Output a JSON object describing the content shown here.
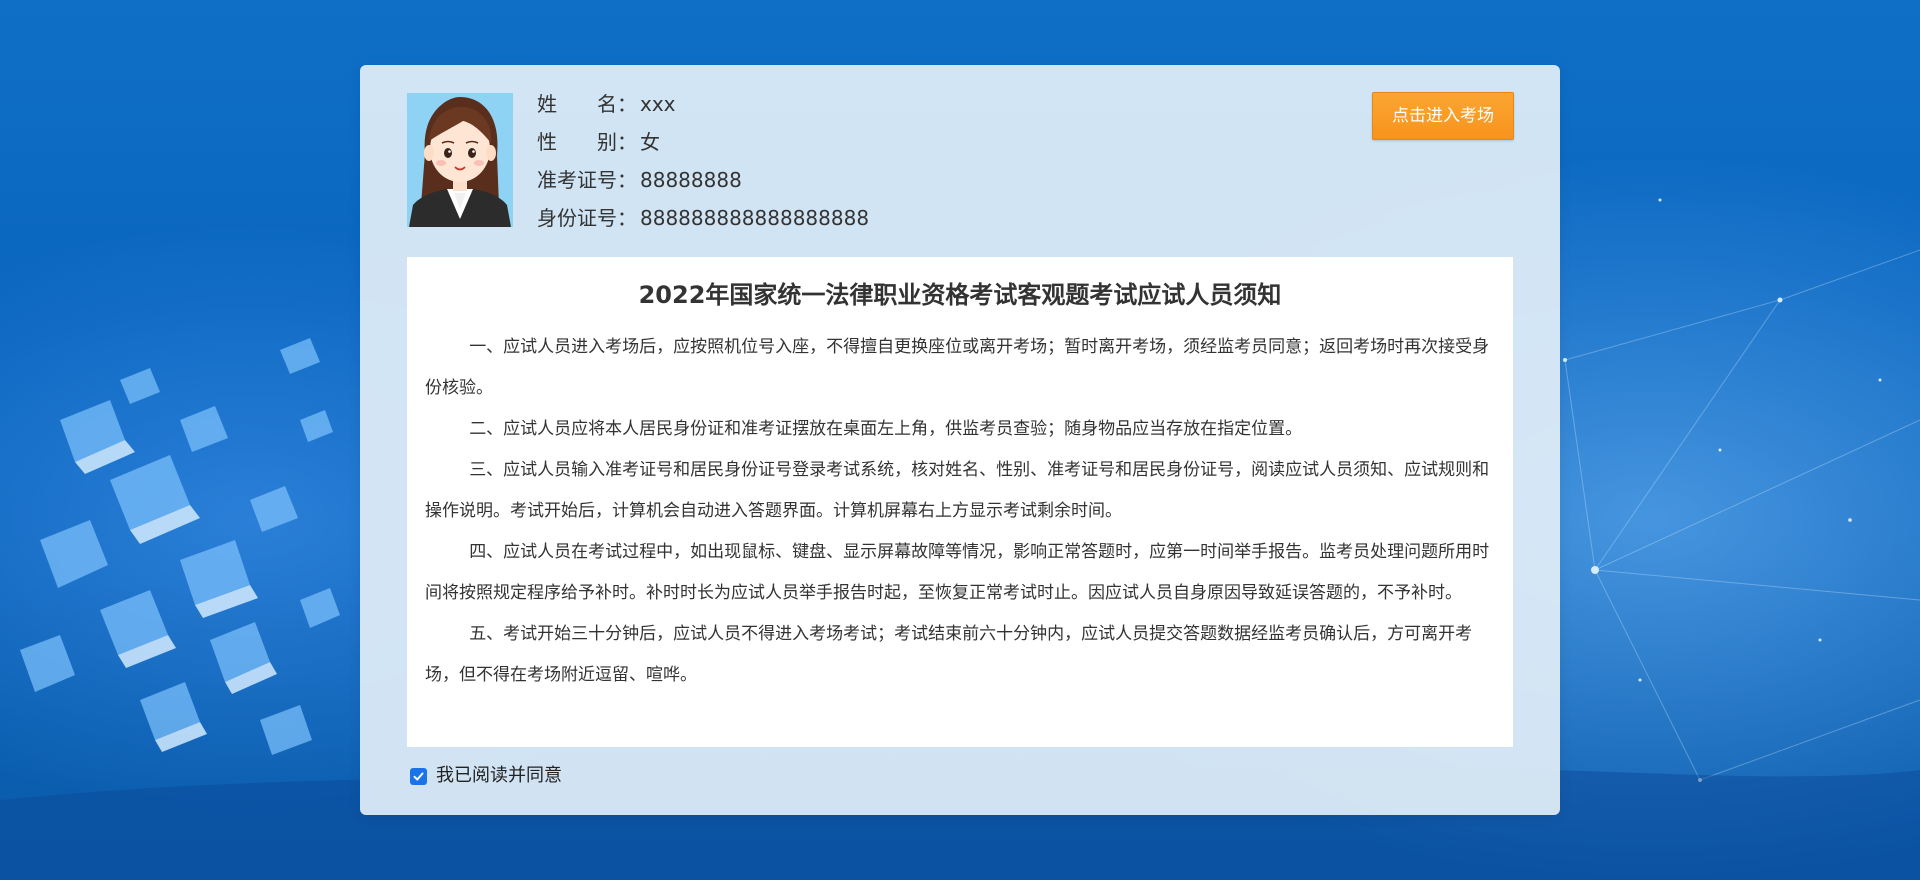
{
  "colors": {
    "accent_button": "#f7941d",
    "checkbox": "#1a73e8",
    "background": "#0a66bf"
  },
  "candidate": {
    "name_label": "姓　　名：",
    "name_value": "xxx",
    "gender_label": "性　　别：",
    "gender_value": "女",
    "ticket_label": "准考证号：",
    "ticket_value": "88888888",
    "id_label": "身份证号：",
    "id_value": "888888888888888888",
    "avatar_icon": "female-avatar-icon"
  },
  "actions": {
    "enter_exam_label": "点击进入考场"
  },
  "notice": {
    "title": "2022年国家统一法律职业资格考试客观题考试应试人员须知",
    "paragraphs": [
      "一、应试人员进入考场后，应按照机位号入座，不得擅自更换座位或离开考场；暂时离开考场，须经监考员同意；返回考场时再次接受身份核验。",
      "二、应试人员应将本人居民身份证和准考证摆放在桌面左上角，供监考员查验；随身物品应当存放在指定位置。",
      "三、应试人员输入准考证号和居民身份证号登录考试系统，核对姓名、性别、准考证号和居民身份证号，阅读应试人员须知、应试规则和操作说明。考试开始后，计算机会自动进入答题界面。计算机屏幕右上方显示考试剩余时间。",
      "四、应试人员在考试过程中，如出现鼠标、键盘、显示屏幕故障等情况，影响正常答题时，应第一时间举手报告。监考员处理问题所用时间将按照规定程序给予补时。补时时长为应试人员举手报告时起，至恢复正常考试时止。因应试人员自身原因导致延误答题的，不予补时。",
      "五、考试开始三十分钟后，应试人员不得进入考场考试；考试结束前六十分钟内，应试人员提交答题数据经监考员确认后，方可离开考场，但不得在考场附近逗留、喧哗。"
    ]
  },
  "agreement": {
    "checked": true,
    "label": "我已阅读并同意"
  }
}
